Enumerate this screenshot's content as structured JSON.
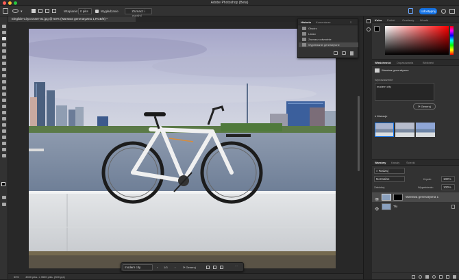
{
  "window": {
    "title": "Adobe Photoshop (Beta)"
  },
  "options_bar": {
    "feather_label": "Wtapianie:",
    "feather_value": "0 piks",
    "antialias_label": "Wygładzanie",
    "select_mask_label": "Zaznacz i maskuj...",
    "share_label": "Udostępnij"
  },
  "document": {
    "tab_title": "Elegilde-Citycrosser-01.jpg @ 50% (Warstwa generatywna 1,RGB/8) *"
  },
  "history": {
    "tab_history": "Historia",
    "tab_comments": "Komentarze",
    "items": [
      "Otwórz",
      "Lasso",
      "Zaznacz odwrotnie",
      "Wypełnianie generatywne"
    ]
  },
  "color_panel": {
    "tabs": [
      "Kolor",
      "Próbki",
      "Gradienty",
      "Wzorki"
    ]
  },
  "properties_panel": {
    "tabs": [
      "Właściwości",
      "Dopasowania",
      "Biblioteki"
    ],
    "layer_label": "Warstwa generatywna",
    "prompt_label": "Wprowadzenie",
    "prompt_text": "modern city",
    "generate_label": "Generuj",
    "variations_label": "Wariacje"
  },
  "layers_panel": {
    "tabs": [
      "Warstwy",
      "Kanały",
      "Ścieżki"
    ],
    "kind_label": "Rodzaj",
    "blend_mode": "Normalne",
    "opacity_label": "Krycie:",
    "opacity_value": "100%",
    "lock_label": "Zablokuj:",
    "fill_label": "Wypełnienie:",
    "fill_value": "100%",
    "layers": [
      {
        "name": "Warstwa generatywna 1"
      },
      {
        "name": "Tło"
      }
    ]
  },
  "contextual_bar": {
    "prompt": "modern city",
    "page": "1/3",
    "generate_label": "Generuj"
  },
  "status_bar": {
    "zoom": "50%",
    "info": "4500 piks. x 3500 piks. (300 ppi)"
  },
  "colors": {
    "accent": "#1473e6",
    "panel": "#323232",
    "canvas_bg": "#282828"
  }
}
